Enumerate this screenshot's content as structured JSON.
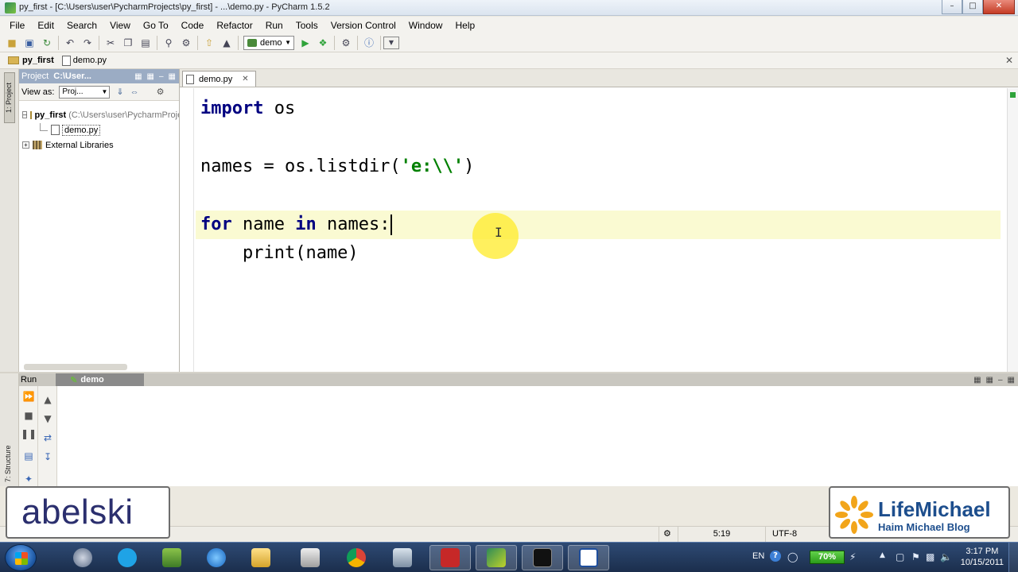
{
  "window": {
    "title": "py_first - [C:\\Users\\user\\PycharmProjects\\py_first] - ...\\demo.py - PyCharm 1.5.2",
    "min": "–",
    "max": "□",
    "close": "✕"
  },
  "menu": [
    "File",
    "Edit",
    "Search",
    "View",
    "Go To",
    "Code",
    "Refactor",
    "Run",
    "Tools",
    "Version Control",
    "Window",
    "Help"
  ],
  "toolbar": {
    "run_config": "demo"
  },
  "navbar": {
    "project": "py_first",
    "file": "demo.py"
  },
  "side_tabs": {
    "project": "1: Project",
    "structure": "7: Structure"
  },
  "project_panel": {
    "header_label": "Project",
    "header_path": "C:\\User...",
    "view_as_label": "View as:",
    "view_as_value": "Proj...",
    "tree": {
      "root": "py_first",
      "root_path": "(C:\\Users\\user\\PycharmProjects\\py_first)",
      "file": "demo.py",
      "libraries": "External Libraries"
    }
  },
  "editor": {
    "tab_label": "demo.py",
    "lines": {
      "l1_kw": "import",
      "l1_rest": " os",
      "l3_pre": "names = os.listdir(",
      "l3_str": "'e:\\\\'",
      "l3_post": ")",
      "l5_kw1": "for",
      "l5_mid": " name ",
      "l5_kw2": "in",
      "l5_post": " names:",
      "l6": "    print(name)"
    }
  },
  "run_panel": {
    "label": "Run",
    "tab": "demo"
  },
  "statusbar": {
    "position": "5:19",
    "encoding": "UTF-8"
  },
  "watermarks": {
    "left": "abelski",
    "right_brand": "LifeMichael",
    "right_sub": "Haim Michael Blog"
  },
  "taskbar": {
    "lang": "EN",
    "battery": "70%",
    "time": "3:17 PM",
    "date": "10/15/2011"
  }
}
